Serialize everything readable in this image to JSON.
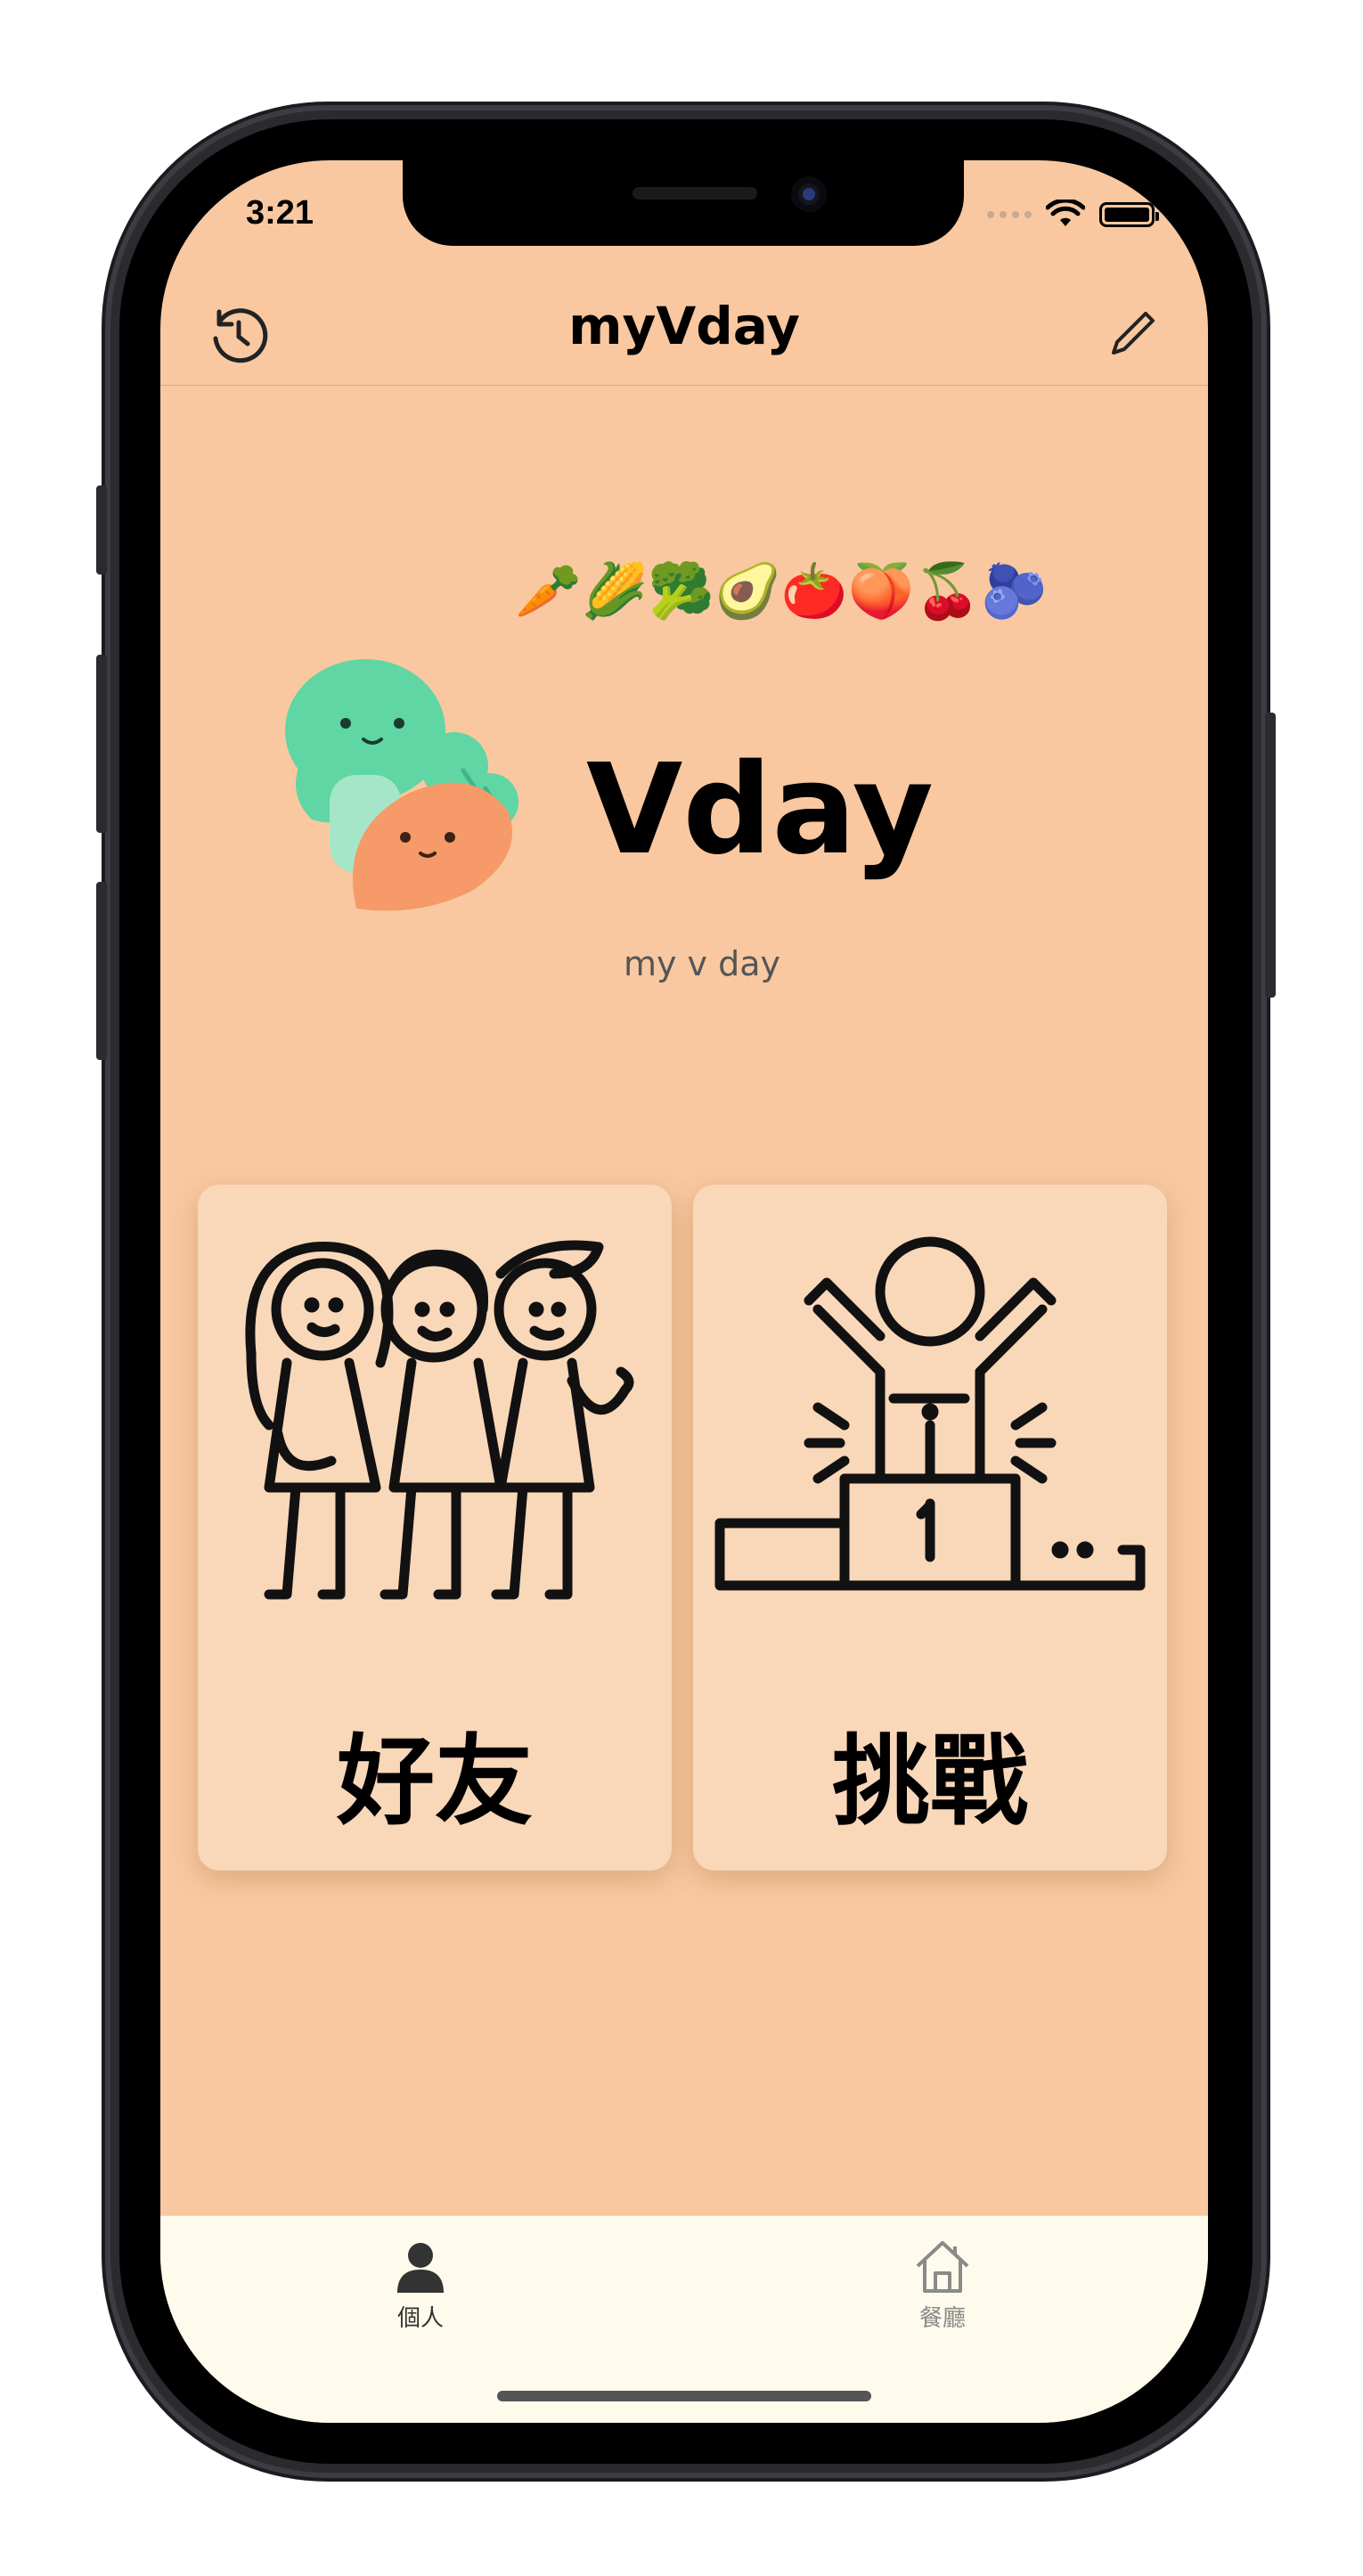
{
  "status_bar": {
    "time": "3:21"
  },
  "nav": {
    "title": "myVday",
    "left_icon": "history-icon",
    "right_icon": "pencil-icon"
  },
  "hero": {
    "emoji_row": "🥕🌽🥦🥑🍅🍑🍒🫐",
    "brand_name": "Vday",
    "tagline": "my v day"
  },
  "cards": [
    {
      "label": "好友",
      "icon": "friends-illustration"
    },
    {
      "label": "挑戰",
      "icon": "podium-winner-illustration"
    }
  ],
  "tab_bar": {
    "items": [
      {
        "label": "個人",
        "icon": "person-icon",
        "selected": true
      },
      {
        "label": "餐廳",
        "icon": "house-icon",
        "selected": false
      }
    ]
  },
  "colors": {
    "background": "#f9c8a0",
    "card": "#f9d7b9",
    "tab_bar": "#fefbec",
    "tab_selected": "#333333",
    "tab_unselected": "#8a8a8a"
  }
}
